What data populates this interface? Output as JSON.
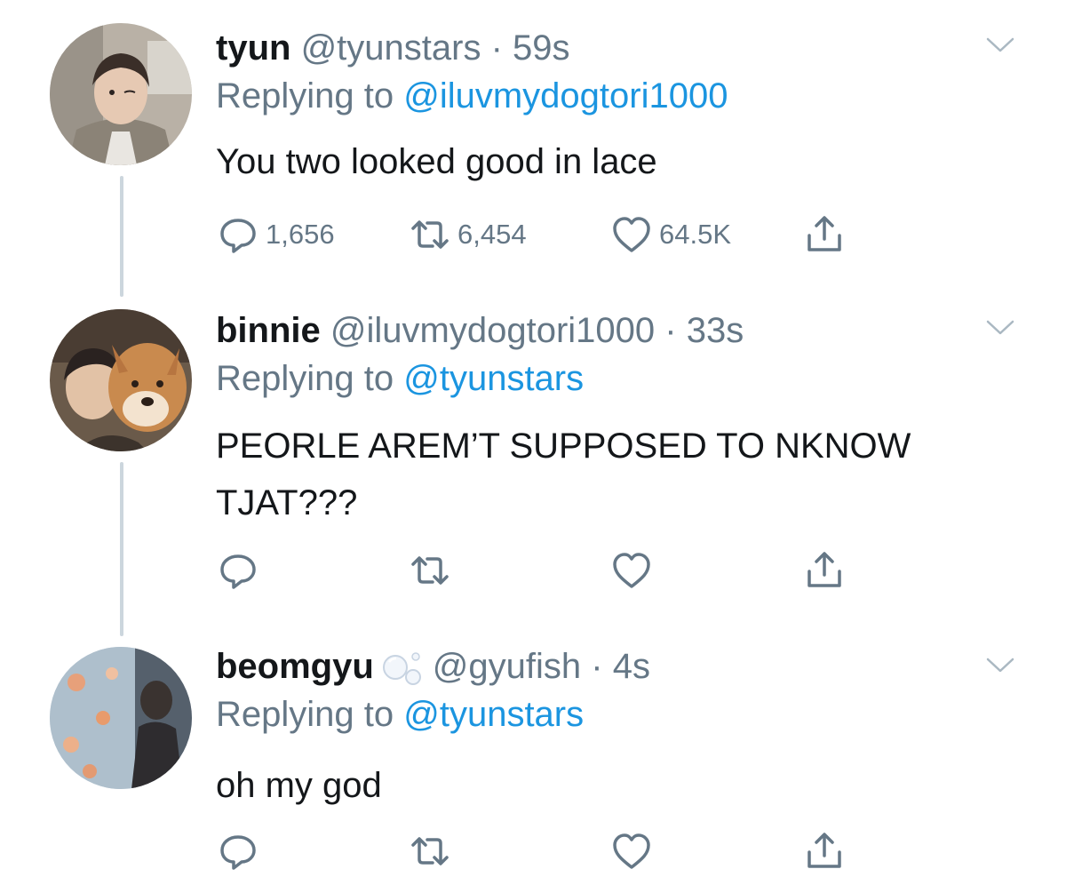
{
  "tweets": [
    {
      "name": "tyun",
      "handle": "@tyunstars",
      "separator": "·",
      "time": "59s",
      "replying_prefix": "Replying to ",
      "replying_to": "@iluvmydogtori1000",
      "text": "You two looked good in lace",
      "actions": {
        "replies": "1,656",
        "retweets": "6,454",
        "likes": "64.5K"
      }
    },
    {
      "name": "binnie",
      "handle": "@iluvmydogtori1000",
      "separator": "·",
      "time": "33s",
      "replying_prefix": "Replying to ",
      "replying_to": "@tyunstars",
      "text": "PEORLE AREM’T SUPPOSED TO NKNOW TJAT???",
      "actions": {
        "replies": "",
        "retweets": "",
        "likes": ""
      }
    },
    {
      "name": "beomgyu",
      "handle": "@gyufish",
      "separator": "·",
      "time": "4s",
      "replying_prefix": "Replying to ",
      "replying_to": "@tyunstars",
      "text": "oh my god",
      "actions": {
        "replies": "",
        "retweets": "",
        "likes": ""
      }
    }
  ],
  "icons": {
    "reply": "reply-icon",
    "retweet": "retweet-icon",
    "like": "heart-icon",
    "share": "share-icon",
    "more": "chevron-down-icon",
    "badge": "bubbles-icon"
  },
  "colors": {
    "text": "#14171a",
    "secondary": "#657786",
    "link": "#1b95e0",
    "thread_line": "#ccd6dd"
  }
}
